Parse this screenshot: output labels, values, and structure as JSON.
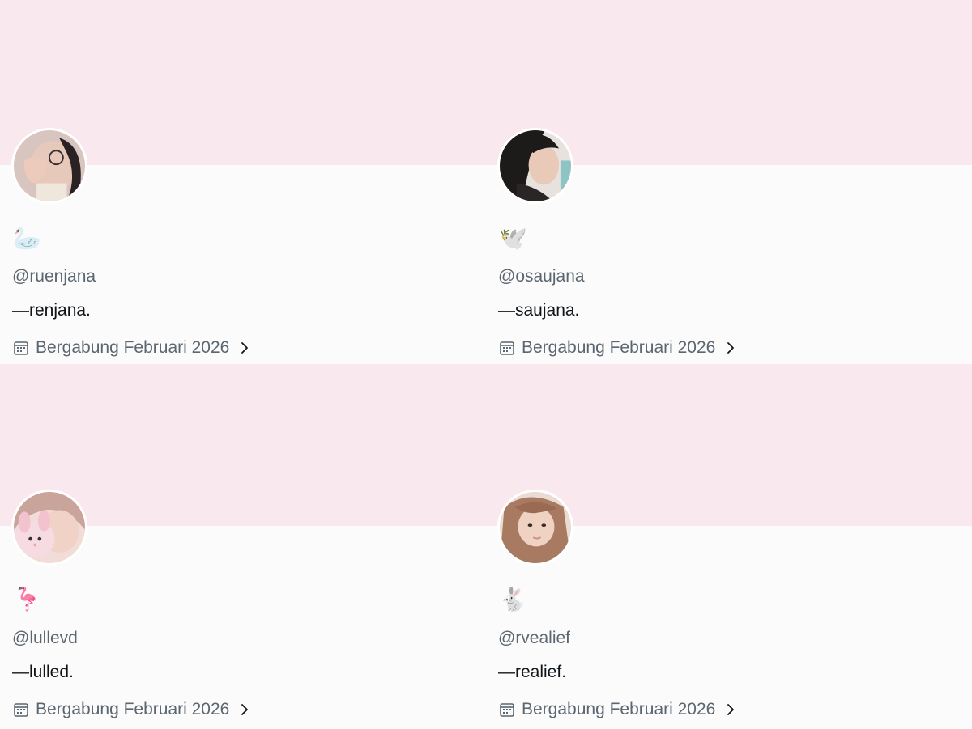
{
  "profiles": [
    {
      "emoji": "🦢",
      "handle": "@ruenjana",
      "bio": "—renjana.",
      "joined": "Bergabung Februari 2026"
    },
    {
      "emoji": "🕊️",
      "handle": "@osaujana",
      "bio": "—saujana.",
      "joined": "Bergabung Februari 2026"
    },
    {
      "emoji": "🦩",
      "handle": "@lullevd",
      "bio": "—lulled.",
      "joined": "Bergabung Februari 2026"
    },
    {
      "emoji": "🐇",
      "handle": "@rvealief",
      "bio": "—realief.",
      "joined": "Bergabung Februari 2026"
    }
  ],
  "colors": {
    "banner": "#fae8ef",
    "background": "#fbfbfb",
    "secondary_text": "#5b6670",
    "primary_text": "#0f1419"
  },
  "icons": {
    "joined": "calendar-icon",
    "more": "chevron-right-icon"
  }
}
